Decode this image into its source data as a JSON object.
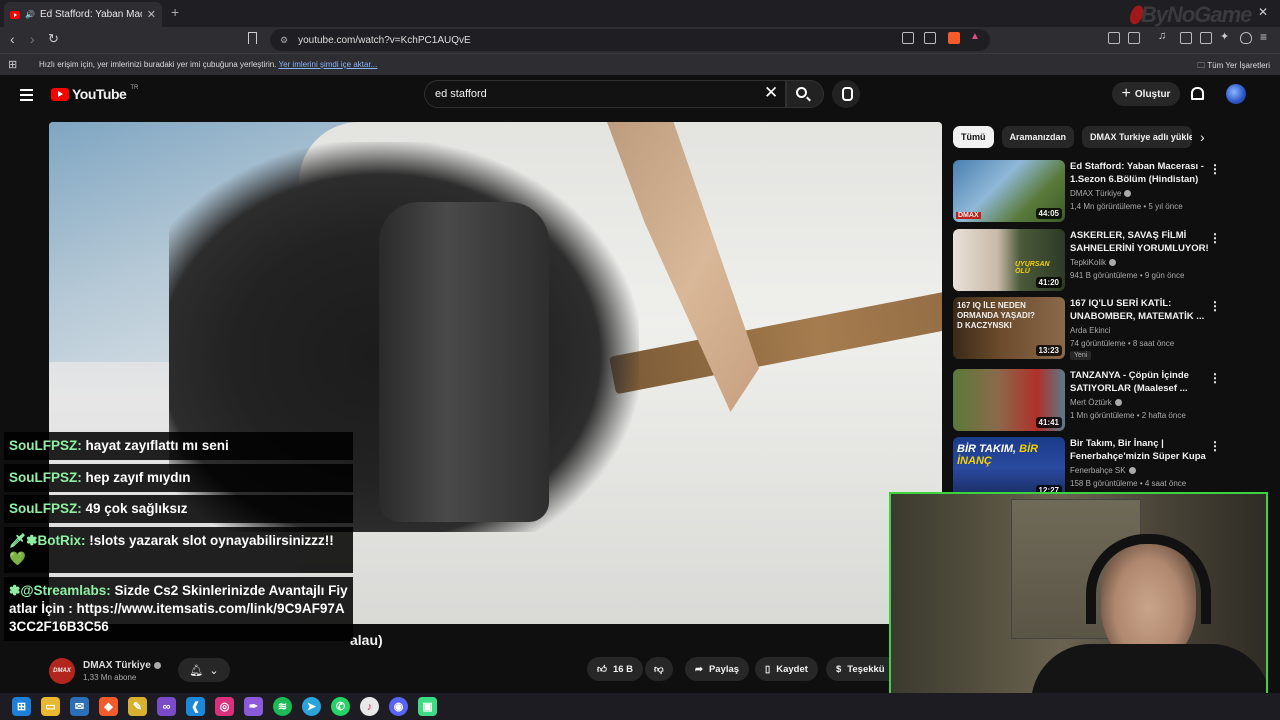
{
  "browser": {
    "tab_title": "Ed Stafford: Yaban Maceras",
    "tab_close": "✕",
    "new_tab": "+",
    "window_close": "✕",
    "url": "youtube.com/watch?v=KchPC1AUQvE",
    "watermark": "ByNoGame",
    "bookmarks_hint": "Hızlı erişim için, yer imlerinizi buradaki yer imi çubuğuna yerleştirin.",
    "bookmarks_import_link": "Yer imlerini şimdi içe aktar...",
    "all_bookmarks": "Tüm Yer İşaretleri"
  },
  "youtube": {
    "logo_text": "YouTube",
    "region": "TR",
    "search_value": "ed stafford",
    "create_label": "Oluştur"
  },
  "video": {
    "title_fragment": "alau)",
    "channel_name": "DMAX Türkiye",
    "channel_avatar_text": "DMAX",
    "subscribers": "1,33 Mn abone",
    "likes": "16 B",
    "share_label": "Paylaş",
    "save_label": "Kaydet",
    "thanks_label": "Teşekkü"
  },
  "chips": [
    {
      "label": "Tümü",
      "active": true
    },
    {
      "label": "Aramanızdan",
      "active": false
    },
    {
      "label": "DMAX Turkiye adlı yükle",
      "active": false
    }
  ],
  "recommendations": [
    {
      "title": "Ed Stafford: Yaban Macerası - 1.Sezon 6.Bölüm (Hindistan)",
      "channel": "DMAX Türkiye",
      "verified": true,
      "views": "1,4 Mn görüntüleme",
      "age": "5 yıl önce",
      "duration": "44:05",
      "new": ""
    },
    {
      "title": "ASKERLER, SAVAŞ FİLMİ SAHNELERİNİ YORUMLUYOR!",
      "channel": "TepkiKolik",
      "verified": true,
      "views": "941 B görüntüleme",
      "age": "9 gün önce",
      "duration": "41:20",
      "new": ""
    },
    {
      "title": "167 IQ'LU SERİ KATİL: UNABOMBER, MATEMATİK ...",
      "channel": "Arda Ekinci",
      "verified": false,
      "views": "74 görüntüleme",
      "age": "8 saat önce",
      "duration": "13:23",
      "new": "Yeni"
    },
    {
      "title": "TANZANYA - Çöpün İçinde SATIYORLAR (Maalesef ...",
      "channel": "Mert Öztürk",
      "verified": true,
      "views": "1 Mn görüntüleme",
      "age": "2 hafta önce",
      "duration": "41:41",
      "new": ""
    },
    {
      "title": "Bir Takım, Bir İnanç | Fenerbahçe'mizin Süper Kupa ...",
      "channel": "Fenerbahçe SK",
      "verified": true,
      "views": "158 B görüntüleme",
      "age": "4 saat önce",
      "duration": "12:27",
      "new": ""
    }
  ],
  "chat": [
    {
      "user": "SouLFPSZ:",
      "prefix": "",
      "text": " hayat zayıflattı mı seni"
    },
    {
      "user": "SouLFPSZ:",
      "prefix": "",
      "text": " hep zayıf mıydın"
    },
    {
      "user": "SouLFPSZ:",
      "prefix": "",
      "text": " 49 çok sağlıksız"
    },
    {
      "user": "BotRix:",
      "prefix": "🗡✽",
      "text": " !slots yazarak slot oynayabilirsinizzz!! 💚"
    },
    {
      "user": "@Streamlabs:",
      "prefix": "✽",
      "text": " Sizde Cs2 Skinlerinizde Avantajlı Fiyatlar İçin : https://www.itemsatis.com/link/9C9AF97A3CC2F16B3C56"
    }
  ],
  "taskbar": [
    "windows-icon",
    "file-explorer-icon",
    "mail-icon",
    "brave-icon",
    "paint-icon",
    "visual-studio-icon",
    "vscode-icon",
    "instagram-icon",
    "feather-icon",
    "spotify-icon",
    "telegram-icon",
    "whatsapp-icon",
    "music-icon",
    "discord-icon",
    "android-icon"
  ],
  "colors": {
    "accent": "#ff0000",
    "chat_user": "#8ff0a4",
    "cam_border": "#3cd33c"
  }
}
